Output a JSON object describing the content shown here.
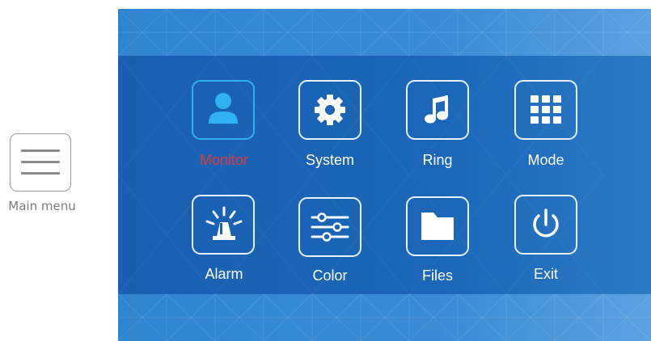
{
  "side": {
    "caption": "Main menu",
    "icon": "hamburger-menu-icon"
  },
  "menu": {
    "items": [
      {
        "label": "Monitor",
        "icon": "person-icon",
        "selected": true
      },
      {
        "label": "System",
        "icon": "gear-icon",
        "selected": false
      },
      {
        "label": "Ring",
        "icon": "music-note-icon",
        "selected": false
      },
      {
        "label": "Mode",
        "icon": "grid-icon",
        "selected": false
      },
      {
        "label": "Alarm",
        "icon": "alarm-siren-icon",
        "selected": false
      },
      {
        "label": "Color",
        "icon": "sliders-icon",
        "selected": false
      },
      {
        "label": "Files",
        "icon": "folder-icon",
        "selected": false
      },
      {
        "label": "Exit",
        "icon": "power-icon",
        "selected": false
      }
    ]
  },
  "colors": {
    "screen_bg": "#1a64b6",
    "selected_label": "#e03b34",
    "selected_border": "#2fb2f4"
  }
}
